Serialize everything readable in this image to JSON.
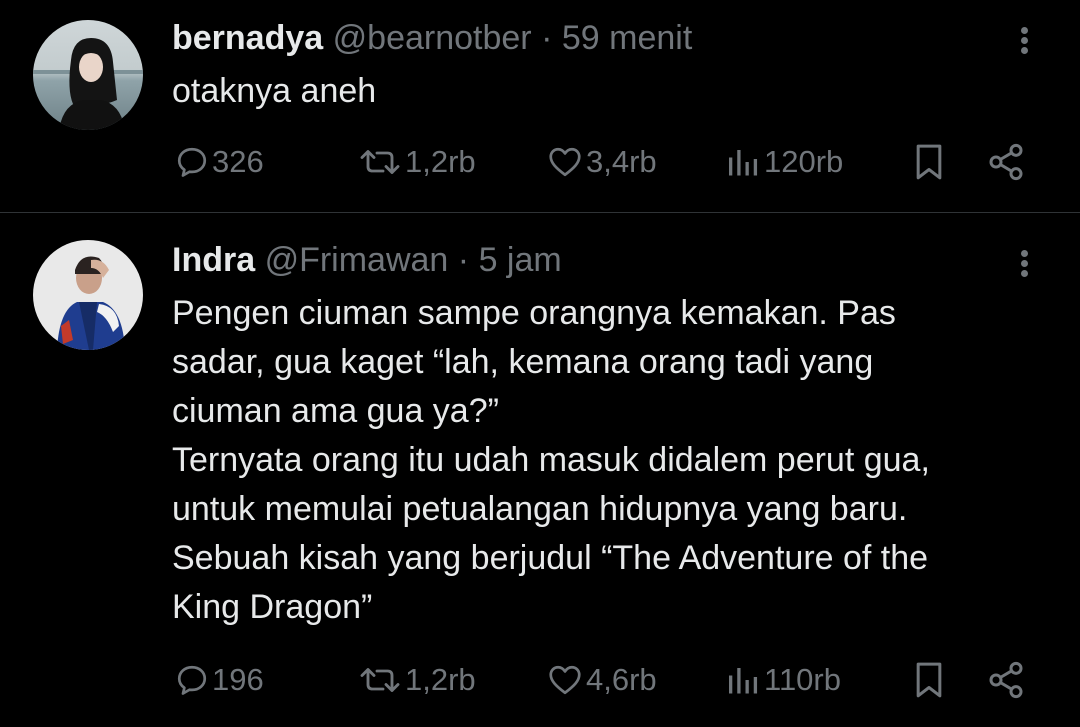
{
  "colors": {
    "background": "#000000",
    "text_primary": "#e7e9ea",
    "text_secondary": "#71767b",
    "divider": "#2f3336"
  },
  "tweets": [
    {
      "name": "bernadya",
      "handle": "@bearnotber",
      "separator": "·",
      "time": "59 menit",
      "text_lines": [
        "otaknya aneh"
      ],
      "replies": "326",
      "reposts": "1,2rb",
      "likes": "3,4rb",
      "views": "120rb",
      "icons": [
        "more-icon",
        "reply-icon",
        "repost-icon",
        "like-icon",
        "views-icon",
        "bookmark-icon",
        "share-icon"
      ]
    },
    {
      "name": "Indra",
      "handle": "@Frimawan",
      "separator": "·",
      "time": "5 jam",
      "text_lines": [
        "Pengen ciuman sampe orangnya kemakan. Pas",
        "sadar, gua kaget “lah, kemana orang tadi yang",
        "ciuman ama gua ya?”",
        "Ternyata orang itu udah masuk didalem perut gua,",
        "untuk memulai petualangan hidupnya yang baru.",
        "Sebuah kisah yang berjudul “The Adventure of the",
        "King Dragon”"
      ],
      "replies": "196",
      "reposts": "1,2rb",
      "likes": "4,6rb",
      "views": "110rb",
      "icons": [
        "more-icon",
        "reply-icon",
        "repost-icon",
        "like-icon",
        "views-icon",
        "bookmark-icon",
        "share-icon"
      ]
    }
  ]
}
